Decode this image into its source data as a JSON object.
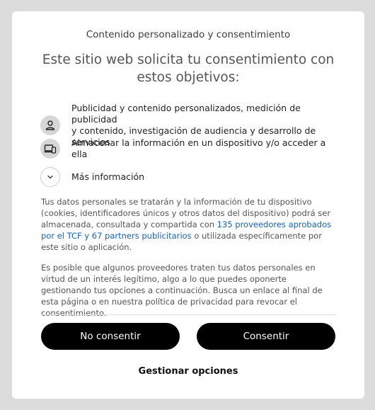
{
  "dialog": {
    "small_title": "Contenido personalizado y consentimiento",
    "heading": "Este sitio web solicita tu consentimiento con estos objetivos:",
    "purposes": [
      {
        "icon": "person-icon",
        "line1": "Publicidad y contenido personalizados, medición de publicidad",
        "line2": "y contenido, investigación de audiencia y desarrollo de servicios"
      },
      {
        "icon": "devices-icon",
        "line1": "Almacenar la información en un dispositivo y/o acceder a ella"
      }
    ],
    "more_info": {
      "icon": "chevron-down-icon",
      "label": "Más información"
    },
    "paragraph1": {
      "part1": "Tus datos personales se tratarán y la información de tu dispositivo (cookies, identificadores únicos y otros datos del dispositivo) podrá ser almacenada, consultada y compartida con ",
      "link": "135 proveedores aprobados por el TCF y 67 partners publicitarios",
      "part2": " o utilizada específicamente por este sitio o aplicación."
    },
    "paragraph2": "Es posible que algunos proveedores traten tus datos personales en virtud de un interés legítimo, algo a lo que puedes oponerte gestionando tus opciones a continuación. Busca un enlace al final de esta página o en nuestra política de privacidad para revocar el consentimiento.",
    "buttons": {
      "reject": "No consentir",
      "accept": "Consentir",
      "manage": "Gestionar opciones"
    }
  }
}
